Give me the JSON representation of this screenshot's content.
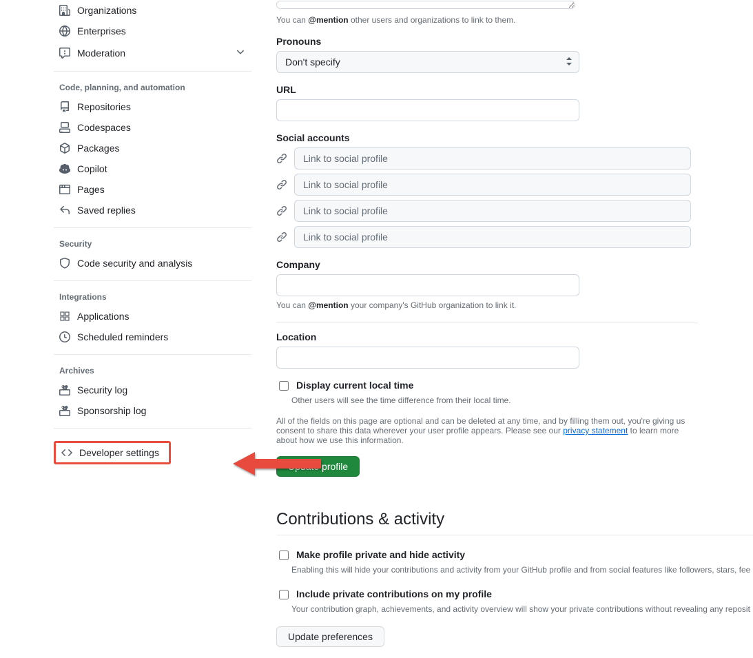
{
  "sidebar": {
    "access": [
      {
        "label": "Organizations"
      },
      {
        "label": "Enterprises"
      },
      {
        "label": "Moderation"
      }
    ],
    "sections": [
      {
        "title": "Code, planning, and automation",
        "items": [
          {
            "label": "Repositories"
          },
          {
            "label": "Codespaces"
          },
          {
            "label": "Packages"
          },
          {
            "label": "Copilot"
          },
          {
            "label": "Pages"
          },
          {
            "label": "Saved replies"
          }
        ]
      },
      {
        "title": "Security",
        "items": [
          {
            "label": "Code security and analysis"
          }
        ]
      },
      {
        "title": "Integrations",
        "items": [
          {
            "label": "Applications"
          },
          {
            "label": "Scheduled reminders"
          }
        ]
      },
      {
        "title": "Archives",
        "items": [
          {
            "label": "Security log"
          },
          {
            "label": "Sponsorship log"
          }
        ]
      }
    ],
    "developer": {
      "label": "Developer settings"
    }
  },
  "form": {
    "bio_note_pre": "You can ",
    "bio_note_strong": "@mention",
    "bio_note_post": " other users and organizations to link to them.",
    "pronouns": {
      "label": "Pronouns",
      "value": "Don't specify"
    },
    "url": {
      "label": "URL"
    },
    "social": {
      "label": "Social accounts",
      "placeholder": "Link to social profile"
    },
    "company": {
      "label": "Company",
      "note_pre": "You can ",
      "note_strong": "@mention",
      "note_post": " your company's GitHub organization to link it."
    },
    "location": {
      "label": "Location"
    },
    "localtime": {
      "label": "Display current local time",
      "desc": "Other users will see the time difference from their local time."
    },
    "disclosure_pre": "All of the fields on this page are optional and can be deleted at any time, and by filling them out, you're giving us consent to share this data wherever your user profile appears. Please see our ",
    "disclosure_link": "privacy statement",
    "disclosure_post": " to learn more about how we use this information.",
    "submit": "Update profile"
  },
  "contrib": {
    "heading": "Contributions & activity",
    "private_profile": {
      "label": "Make profile private and hide activity",
      "desc": "Enabling this will hide your contributions and activity from your GitHub profile and from social features like followers, stars, fee"
    },
    "private_contrib": {
      "label": "Include private contributions on my profile",
      "desc": "Your contribution graph, achievements, and activity overview will show your private contributions without revealing any reposit"
    },
    "submit": "Update preferences"
  }
}
